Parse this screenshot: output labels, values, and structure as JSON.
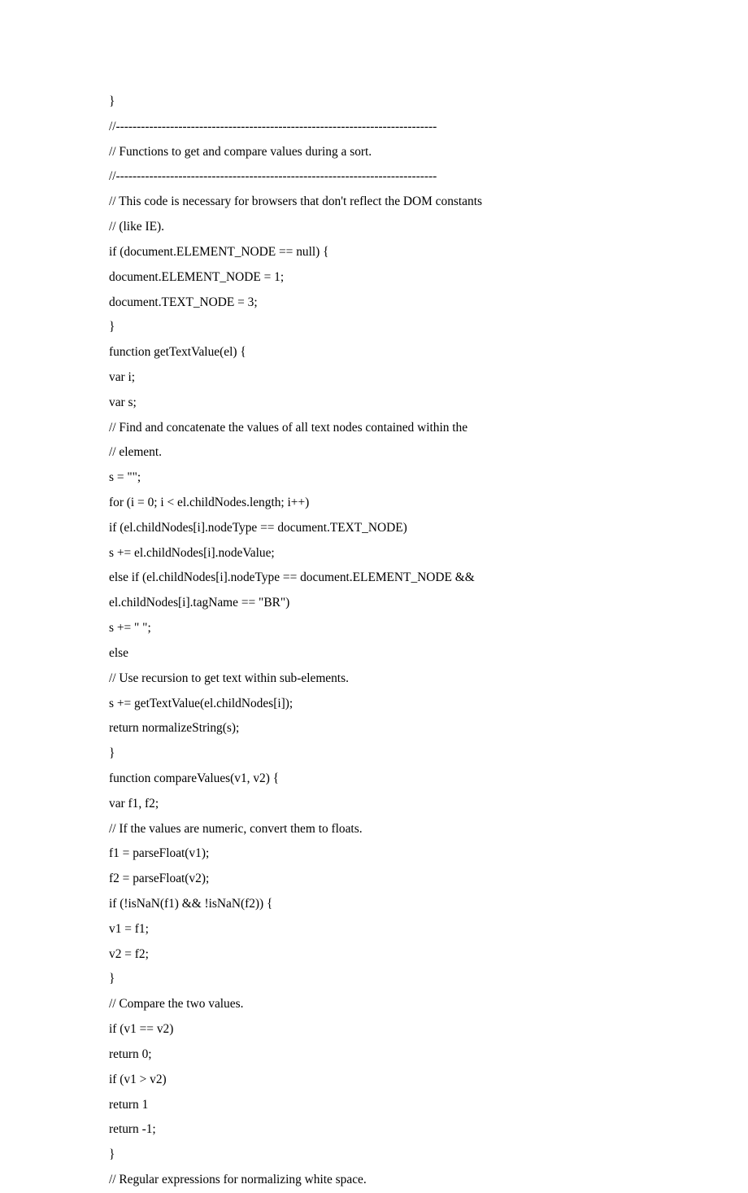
{
  "lines": [
    "}",
    "//-----------------------------------------------------------------------------",
    "// Functions to get and compare values during a sort.",
    "//-----------------------------------------------------------------------------",
    "// This code is necessary for browsers that don't reflect the DOM constants",
    "// (like IE).",
    "if (document.ELEMENT_NODE == null) {",
    "document.ELEMENT_NODE = 1;",
    "document.TEXT_NODE = 3;",
    "}",
    "function getTextValue(el) {",
    "var i;",
    "var s;",
    "// Find and concatenate the values of all text nodes contained within the",
    "// element.",
    "s = \"\";",
    "for (i = 0; i < el.childNodes.length; i++)",
    "if (el.childNodes[i].nodeType == document.TEXT_NODE)",
    "s += el.childNodes[i].nodeValue;",
    "else if (el.childNodes[i].nodeType == document.ELEMENT_NODE &&",
    "el.childNodes[i].tagName == \"BR\")",
    "s += \" \";",
    "else",
    "// Use recursion to get text within sub-elements.",
    "s += getTextValue(el.childNodes[i]);",
    "return normalizeString(s);",
    "}",
    "function compareValues(v1, v2) {",
    "var f1, f2;",
    "// If the values are numeric, convert them to floats.",
    "f1 = parseFloat(v1);",
    "f2 = parseFloat(v2);",
    "if (!isNaN(f1) && !isNaN(f2)) {",
    "v1 = f1;",
    "v2 = f2;",
    "}",
    "// Compare the two values.",
    "if (v1 == v2)",
    "return 0;",
    "if (v1 > v2)",
    "return 1 ",
    "return -1;",
    "}",
    "// Regular expressions for normalizing white space."
  ]
}
